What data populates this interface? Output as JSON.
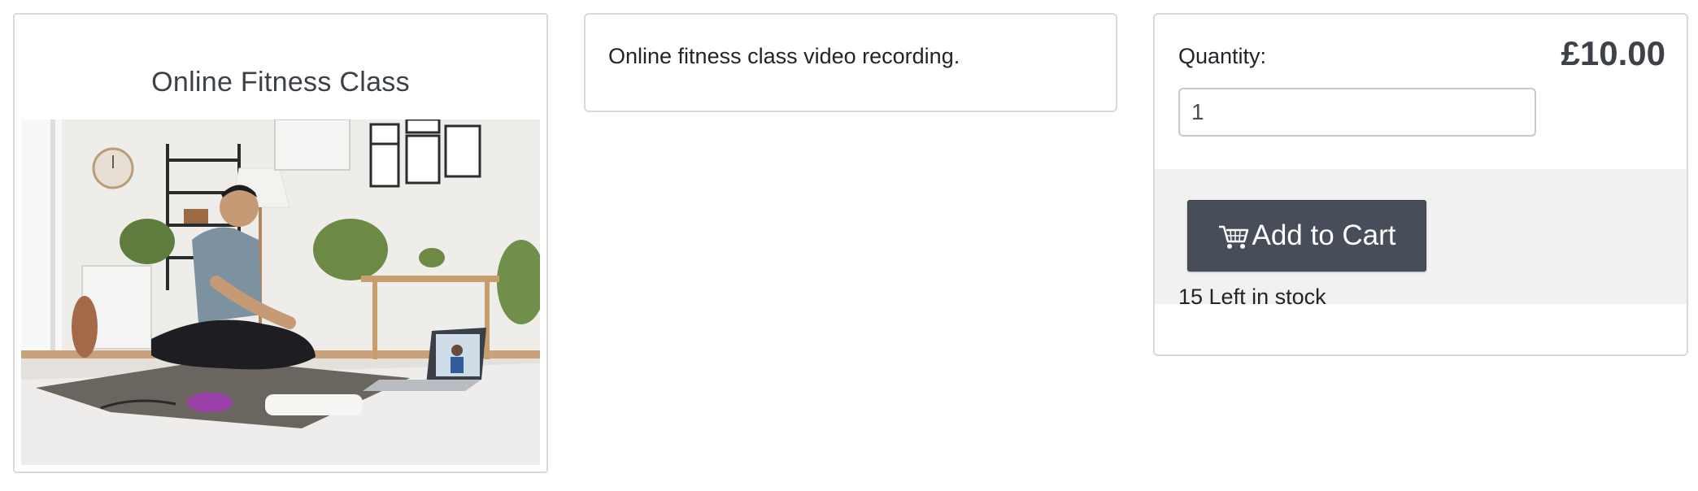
{
  "product": {
    "title": "Online Fitness Class",
    "image_alt": "Man sitting cross-legged on a yoga mat in a living room watching a fitness class on a laptop"
  },
  "description": {
    "text": "Online fitness class video recording."
  },
  "purchase": {
    "quantity_label": "Quantity:",
    "price": "£10.00",
    "quantity_value": "1",
    "add_to_cart_label": "Add to Cart",
    "cart_icon": "shopping-cart-icon",
    "stock_text": "15 Left in stock"
  },
  "colors": {
    "button_bg": "#474e59",
    "cart_area_bg": "#f1f1f2",
    "card_border": "#d9d9dc"
  }
}
